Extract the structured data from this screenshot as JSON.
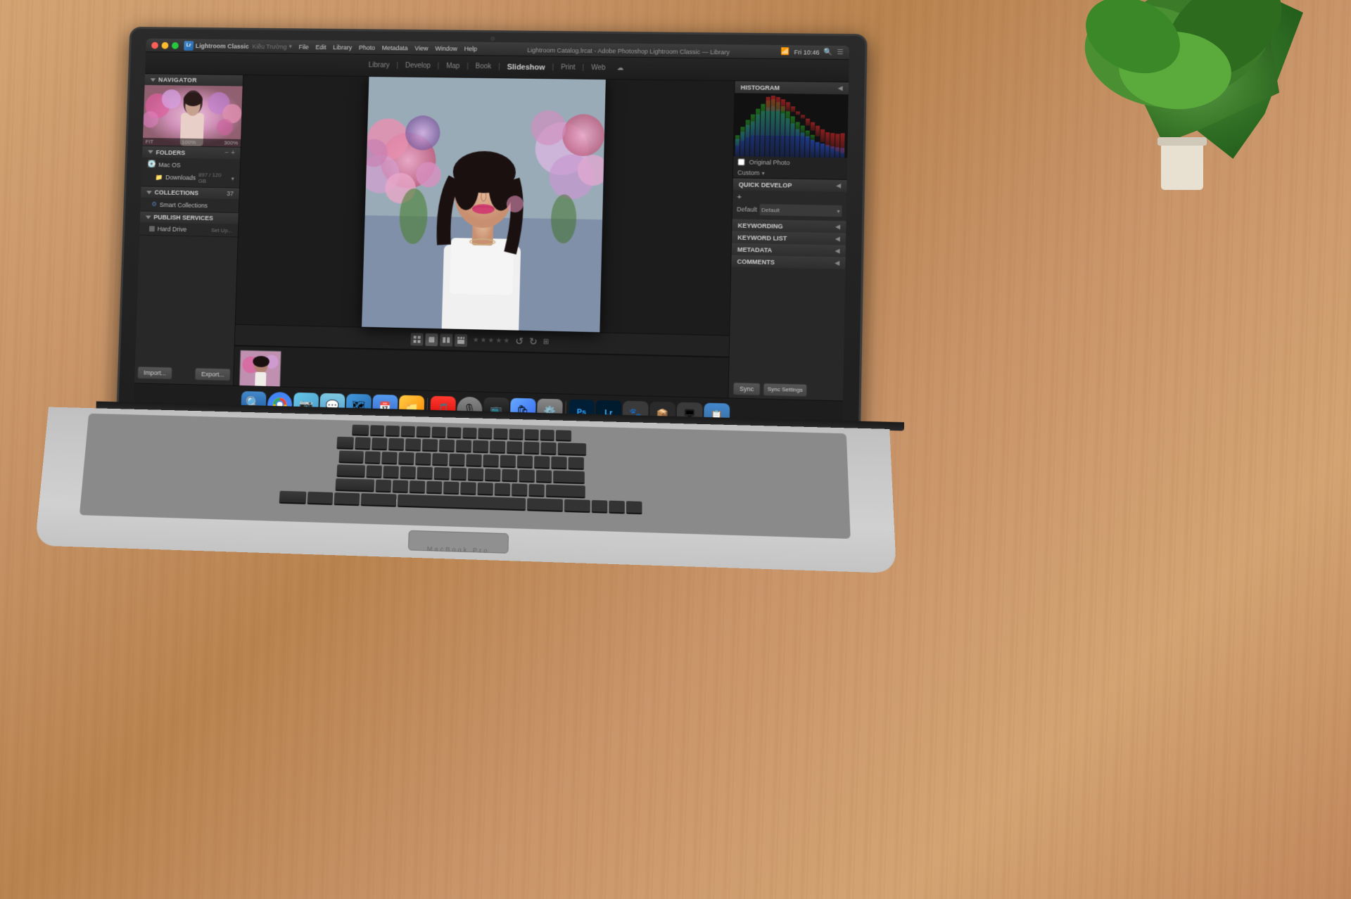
{
  "app": {
    "title": "Lightroom Classic",
    "window_title": "Lightroom Catalog.lrcat - Adobe Photoshop Lightroom Classic — Library"
  },
  "titlebar": {
    "app_name": "Lightroom Classic",
    "menus": [
      "File",
      "Edit",
      "Library",
      "Photo",
      "Metadata",
      "View",
      "Window",
      "Help"
    ],
    "clock": "Fri 10:46",
    "user": "Kiều Trường"
  },
  "modules": {
    "tabs": [
      "Library",
      "Develop",
      "Map",
      "Book",
      "Slideshow",
      "Print",
      "Web"
    ],
    "active": "Library"
  },
  "left_panel": {
    "navigator": {
      "label": "Navigator",
      "zoom_options": [
        "FIT",
        "100%",
        "300%"
      ]
    },
    "folders": {
      "label": "Folders",
      "items": [
        {
          "name": "Mac OS",
          "type": "drive"
        },
        {
          "name": "Downloads",
          "badge": "897 / 120 GB",
          "type": "folder"
        }
      ]
    },
    "collections": {
      "label": "Collections",
      "count": "37",
      "items": [
        {
          "name": "Smart Collections",
          "type": "smart"
        }
      ]
    },
    "publish_services": {
      "label": "Publish Services",
      "items": [
        {
          "name": "Hard Drive",
          "type": "drive"
        }
      ]
    },
    "buttons": {
      "import": "Import...",
      "export": "Export..."
    }
  },
  "right_panel": {
    "histogram": {
      "label": "Histogram",
      "checkbox_label": "Original Photo",
      "dropdown_label": "Custom"
    },
    "sections": [
      {
        "label": "Quick Develop",
        "expanded": true
      },
      {
        "label": "Keywording",
        "expanded": false
      },
      {
        "label": "Keyword List",
        "expanded": false
      },
      {
        "label": "Metadata",
        "expanded": false
      },
      {
        "label": "Comments",
        "expanded": false
      }
    ],
    "quick_develop": {
      "dropdown1_label": "Default",
      "plus_btn": "+",
      "sync_btn": "Sync",
      "sync_settings_btn": "Sync Settings"
    }
  },
  "filmstrip": {
    "stars": [
      "★",
      "★",
      "★",
      "★",
      "★"
    ]
  },
  "dock": {
    "icons": [
      "🔍",
      "🌐",
      "📷",
      "🎵",
      "🗺",
      "💬",
      "📱",
      "🎨",
      "📅",
      "📂",
      "🎬",
      "🎧",
      "📺",
      "⚙️",
      "🔧",
      "🖨",
      "PS",
      "Lr",
      "🐾",
      "📦",
      "🖥"
    ]
  },
  "macbook": {
    "label": "MacBook Pro"
  }
}
